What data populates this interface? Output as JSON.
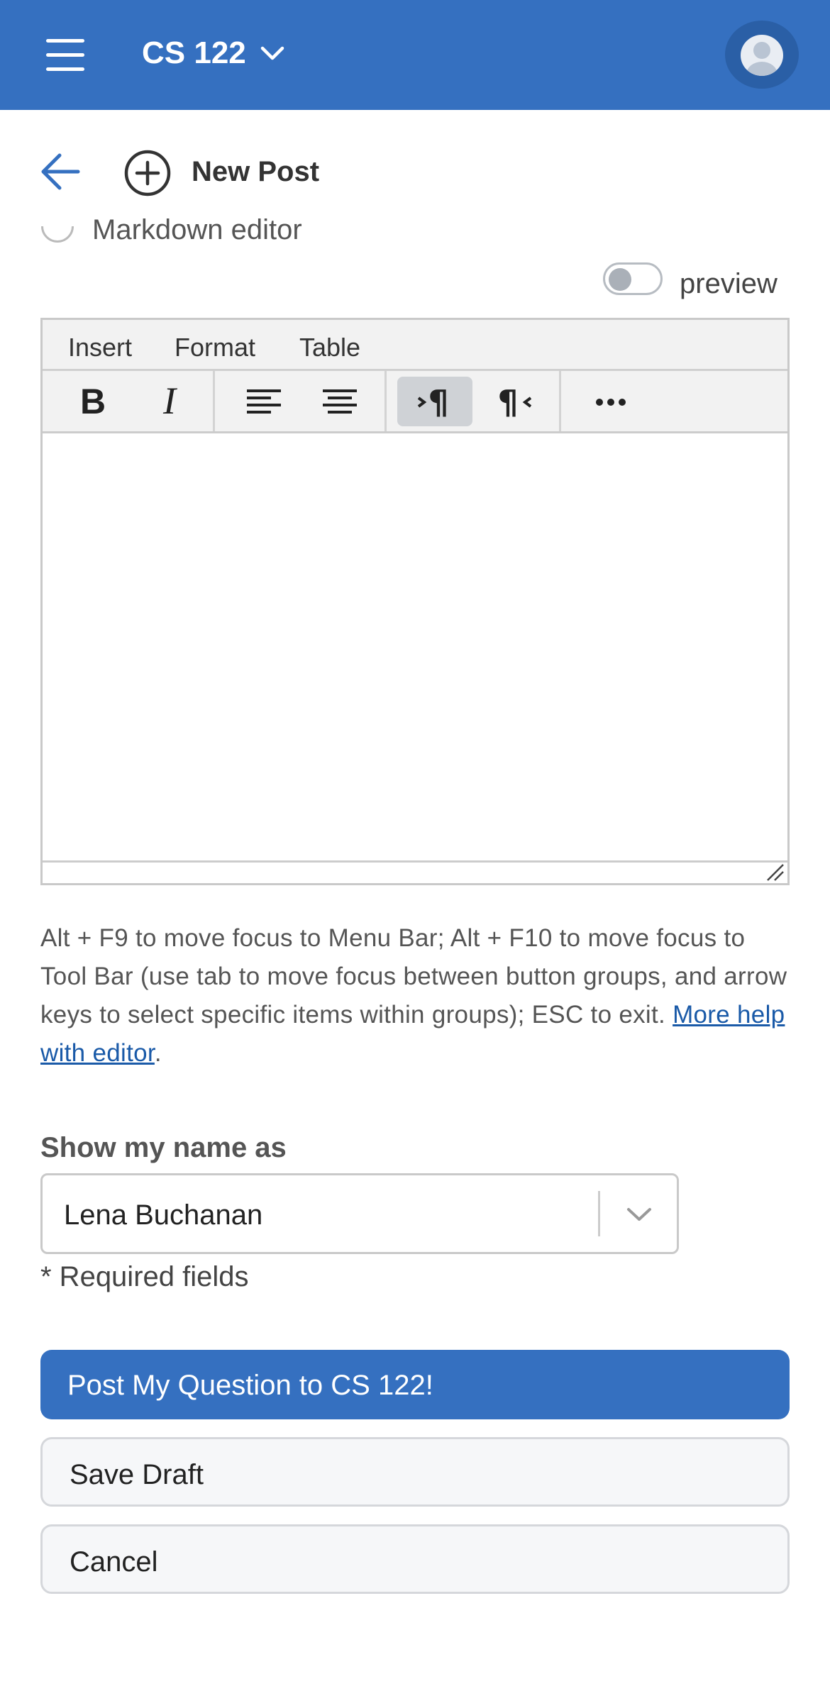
{
  "header": {
    "course_title": "CS 122",
    "accent_color": "#3570c0"
  },
  "subheader": {
    "title": "New Post",
    "partial_option_label": "Markdown editor"
  },
  "preview": {
    "label": "preview",
    "enabled": false
  },
  "editor": {
    "menu": [
      "Insert",
      "Format",
      "Table"
    ],
    "toolbar": [
      "bold-icon",
      "italic-icon",
      "align-left-icon",
      "align-center-icon",
      "ltr-paragraph-icon",
      "rtl-paragraph-icon",
      "more-icon"
    ],
    "content": ""
  },
  "help": {
    "text": "Alt + F9 to move focus to Menu Bar; Alt + F10 to move focus to Tool Bar (use tab to move focus between button groups, and arrow keys to select specific items within groups); ESC to exit. ",
    "link": "More help with editor",
    "suffix": "."
  },
  "show_name": {
    "label": "Show my name as",
    "value": "Lena Buchanan"
  },
  "required_note": "* Required fields",
  "actions": {
    "post": "Post My Question to CS 122!",
    "save": "Save Draft",
    "cancel": "Cancel"
  }
}
